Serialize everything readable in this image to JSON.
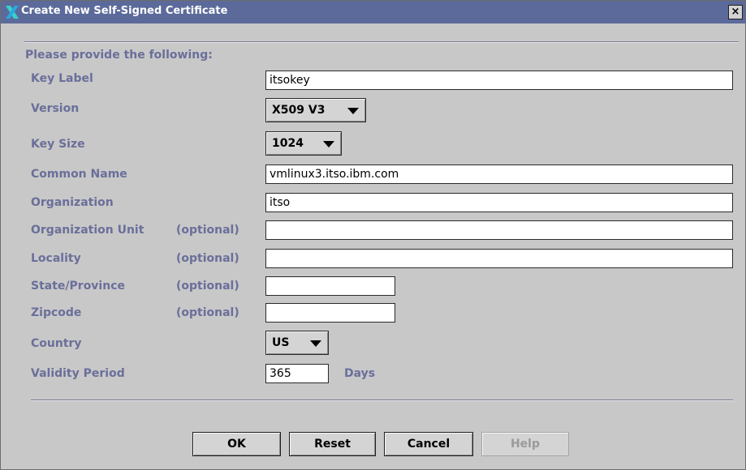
{
  "window": {
    "title": "Create New Self-Signed Certificate",
    "close_glyph": "×"
  },
  "form": {
    "heading": "Please provide the following:",
    "optional_text": "(optional)",
    "key_label": {
      "label": "Key Label",
      "value": "itsokey"
    },
    "version": {
      "label": "Version",
      "selected": "X509 V3"
    },
    "key_size": {
      "label": "Key Size",
      "selected": "1024"
    },
    "common_name": {
      "label": "Common Name",
      "value": "vmlinux3.itso.ibm.com"
    },
    "organization": {
      "label": "Organization",
      "value": "itso"
    },
    "organization_unit": {
      "label": "Organization Unit",
      "value": ""
    },
    "locality": {
      "label": "Locality",
      "value": ""
    },
    "state_province": {
      "label": "State/Province",
      "value": ""
    },
    "zipcode": {
      "label": "Zipcode",
      "value": ""
    },
    "country": {
      "label": "Country",
      "selected": "US"
    },
    "validity_period": {
      "label": "Validity Period",
      "value": "365",
      "unit": "Days"
    }
  },
  "buttons": {
    "ok": "OK",
    "reset": "Reset",
    "cancel": "Cancel",
    "help": "Help"
  },
  "colors": {
    "titlebar": "#5b6a9a",
    "label": "#6a6f9a",
    "background": "#c8c8c8"
  }
}
